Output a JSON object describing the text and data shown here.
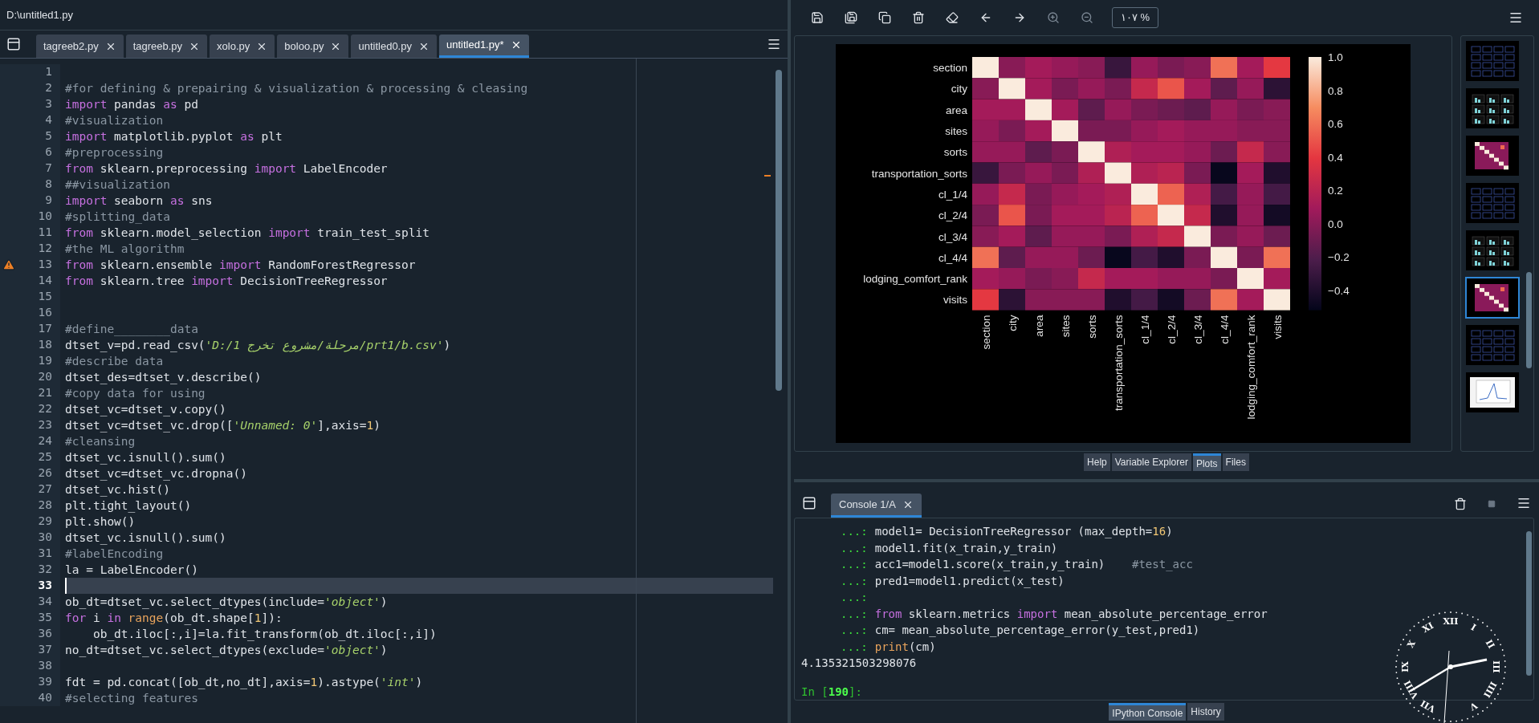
{
  "editor": {
    "path": "D:\\untitled1.py",
    "tabs": [
      {
        "label": "tagreeb2.py",
        "selected": false
      },
      {
        "label": "tagreeb.py",
        "selected": false
      },
      {
        "label": "xolo.py",
        "selected": false
      },
      {
        "label": "boloo.py",
        "selected": false
      },
      {
        "label": "untitled0.py",
        "selected": false
      },
      {
        "label": "untitled1.py*",
        "selected": true
      }
    ],
    "lines": [
      {
        "n": "1",
        "current": false,
        "warning": false
      },
      {
        "n": "2",
        "current": false,
        "warning": false,
        "tokens": [
          {
            "kind": "cm",
            "text": "#for defining & prepairing & visualization & processing & cleasing"
          }
        ]
      },
      {
        "n": "3",
        "current": false,
        "warning": false,
        "tokens": [
          {
            "kind": "kw",
            "text": "import"
          },
          {
            "kind": "p",
            "text": " pandas "
          },
          {
            "kind": "kw",
            "text": "as"
          },
          {
            "kind": "p",
            "text": " pd"
          }
        ]
      },
      {
        "n": "4",
        "current": false,
        "warning": false,
        "tokens": [
          {
            "kind": "cm",
            "text": "#visualization"
          }
        ]
      },
      {
        "n": "5",
        "current": false,
        "warning": false,
        "tokens": [
          {
            "kind": "kw",
            "text": "import"
          },
          {
            "kind": "p",
            "text": " matplotlib.pyplot "
          },
          {
            "kind": "kw",
            "text": "as"
          },
          {
            "kind": "p",
            "text": " plt"
          }
        ]
      },
      {
        "n": "6",
        "current": false,
        "warning": false,
        "tokens": [
          {
            "kind": "cm",
            "text": "#preprocessing"
          }
        ]
      },
      {
        "n": "7",
        "current": false,
        "warning": false,
        "tokens": [
          {
            "kind": "kw",
            "text": "from"
          },
          {
            "kind": "p",
            "text": " sklearn.preprocessing "
          },
          {
            "kind": "kw",
            "text": "import"
          },
          {
            "kind": "p",
            "text": " LabelEncoder"
          }
        ]
      },
      {
        "n": "8",
        "current": false,
        "warning": false,
        "tokens": [
          {
            "kind": "cm",
            "text": "##visualization"
          }
        ]
      },
      {
        "n": "9",
        "current": false,
        "warning": false,
        "tokens": [
          {
            "kind": "kw",
            "text": "import"
          },
          {
            "kind": "p",
            "text": " seaborn "
          },
          {
            "kind": "kw",
            "text": "as"
          },
          {
            "kind": "p",
            "text": " sns"
          }
        ]
      },
      {
        "n": "10",
        "current": false,
        "warning": false,
        "tokens": [
          {
            "kind": "cm",
            "text": "#splitting_data"
          }
        ]
      },
      {
        "n": "11",
        "current": false,
        "warning": false,
        "tokens": [
          {
            "kind": "kw",
            "text": "from"
          },
          {
            "kind": "p",
            "text": " sklearn.model_selection "
          },
          {
            "kind": "kw",
            "text": "import"
          },
          {
            "kind": "p",
            "text": " train_test_split"
          }
        ]
      },
      {
        "n": "12",
        "current": false,
        "warning": false,
        "tokens": [
          {
            "kind": "cm",
            "text": "#the ML algorithm"
          }
        ]
      },
      {
        "n": "13",
        "current": false,
        "warning": true,
        "tokens": [
          {
            "kind": "kw",
            "text": "from"
          },
          {
            "kind": "p",
            "text": " sklearn.ensemble "
          },
          {
            "kind": "kw",
            "text": "import"
          },
          {
            "kind": "p",
            "text": " RandomForestRegressor"
          }
        ]
      },
      {
        "n": "14",
        "current": false,
        "warning": false,
        "tokens": [
          {
            "kind": "kw",
            "text": "from"
          },
          {
            "kind": "p",
            "text": " sklearn.tree "
          },
          {
            "kind": "kw",
            "text": "import"
          },
          {
            "kind": "p",
            "text": " DecisionTreeRegressor"
          }
        ]
      },
      {
        "n": "15",
        "current": false,
        "warning": false
      },
      {
        "n": "16",
        "current": false,
        "warning": false
      },
      {
        "n": "17",
        "current": false,
        "warning": false,
        "tokens": [
          {
            "kind": "cm",
            "text": "#define________data"
          }
        ]
      },
      {
        "n": "18",
        "current": false,
        "warning": false,
        "tokens": [
          {
            "kind": "p",
            "text": "dtset_v=pd.read_csv("
          },
          {
            "kind": "str",
            "text": "'D:/1 مرحلة/مشروع تخرج/prt1/b.csv'"
          },
          {
            "kind": "p",
            "text": ")"
          }
        ]
      },
      {
        "n": "19",
        "current": false,
        "warning": false,
        "tokens": [
          {
            "kind": "cm",
            "text": "#describe data"
          }
        ]
      },
      {
        "n": "20",
        "current": false,
        "warning": false,
        "tokens": [
          {
            "kind": "p",
            "text": "dtset_des=dtset_v.describe()"
          }
        ]
      },
      {
        "n": "21",
        "current": false,
        "warning": false,
        "tokens": [
          {
            "kind": "cm",
            "text": "#copy data for using"
          }
        ]
      },
      {
        "n": "22",
        "current": false,
        "warning": false,
        "tokens": [
          {
            "kind": "p",
            "text": "dtset_vc=dtset_v.copy()"
          }
        ]
      },
      {
        "n": "23",
        "current": false,
        "warning": false,
        "tokens": [
          {
            "kind": "p",
            "text": "dtset_vc=dtset_vc.drop(["
          },
          {
            "kind": "str",
            "text": "'Unnamed: 0'"
          },
          {
            "kind": "p",
            "text": "],axis="
          },
          {
            "kind": "num",
            "text": "1"
          },
          {
            "kind": "p",
            "text": ")"
          }
        ]
      },
      {
        "n": "24",
        "current": false,
        "warning": false,
        "tokens": [
          {
            "kind": "cm",
            "text": "#cleansing"
          }
        ]
      },
      {
        "n": "25",
        "current": false,
        "warning": false,
        "tokens": [
          {
            "kind": "p",
            "text": "dtset_vc.isnull().sum()"
          }
        ]
      },
      {
        "n": "26",
        "current": false,
        "warning": false,
        "tokens": [
          {
            "kind": "p",
            "text": "dtset_vc=dtset_vc.dropna()"
          }
        ]
      },
      {
        "n": "27",
        "current": false,
        "warning": false,
        "tokens": [
          {
            "kind": "p",
            "text": "dtset_vc.hist()"
          }
        ]
      },
      {
        "n": "28",
        "current": false,
        "warning": false,
        "tokens": [
          {
            "kind": "p",
            "text": "plt.tight_layout()"
          }
        ]
      },
      {
        "n": "29",
        "current": false,
        "warning": false,
        "tokens": [
          {
            "kind": "p",
            "text": "plt.show()"
          }
        ]
      },
      {
        "n": "30",
        "current": false,
        "warning": false,
        "tokens": [
          {
            "kind": "p",
            "text": "dtset_vc.isnull().sum()"
          }
        ]
      },
      {
        "n": "31",
        "current": false,
        "warning": false,
        "tokens": [
          {
            "kind": "cm",
            "text": "#labelEncoding"
          }
        ]
      },
      {
        "n": "32",
        "current": false,
        "warning": false,
        "tokens": [
          {
            "kind": "p",
            "text": "la = LabelEncoder()"
          }
        ]
      },
      {
        "n": "33",
        "current": true,
        "warning": false
      },
      {
        "n": "34",
        "current": false,
        "warning": false,
        "tokens": [
          {
            "kind": "p",
            "text": "ob_dt=dtset_vc.select_dtypes(include="
          },
          {
            "kind": "str",
            "text": "'object'"
          },
          {
            "kind": "p",
            "text": ")"
          }
        ]
      },
      {
        "n": "35",
        "current": false,
        "warning": false,
        "tokens": [
          {
            "kind": "kw",
            "text": "for"
          },
          {
            "kind": "p",
            "text": " i "
          },
          {
            "kind": "kw",
            "text": "in"
          },
          {
            "kind": "bi",
            "text": " range"
          },
          {
            "kind": "p",
            "text": "(ob_dt.shape["
          },
          {
            "kind": "num",
            "text": "1"
          },
          {
            "kind": "p",
            "text": "]):"
          }
        ]
      },
      {
        "n": "36",
        "current": false,
        "warning": false,
        "tokens": [
          {
            "kind": "p",
            "text": "    ob_dt.iloc[:,i]=la.fit_transform(ob_dt.iloc[:,i])"
          }
        ]
      },
      {
        "n": "37",
        "current": false,
        "warning": false,
        "tokens": [
          {
            "kind": "p",
            "text": "no_dt=dtset_vc.select_dtypes(exclude="
          },
          {
            "kind": "str",
            "text": "'object'"
          },
          {
            "kind": "p",
            "text": ")"
          }
        ]
      },
      {
        "n": "38",
        "current": false,
        "warning": false
      },
      {
        "n": "39",
        "current": false,
        "warning": false,
        "tokens": [
          {
            "kind": "p",
            "text": "fdt = pd.concat([ob_dt,no_dt],axis="
          },
          {
            "kind": "num",
            "text": "1"
          },
          {
            "kind": "p",
            "text": ").astype("
          },
          {
            "kind": "str",
            "text": "'int'"
          },
          {
            "kind": "p",
            "text": ")"
          }
        ]
      },
      {
        "n": "40",
        "current": false,
        "warning": false,
        "tokens": [
          {
            "kind": "cm",
            "text": "#selecting features"
          }
        ]
      }
    ]
  },
  "plots": {
    "zoom": "١٠٧ %",
    "heatmap": {
      "row_labels": [
        "section",
        "city",
        "area",
        "sites",
        "sorts",
        "transportation_sorts",
        "cl_1/4",
        "cl_2/4",
        "cl_3/4",
        "cl_4/4",
        "lodging_comfort_rank",
        "visits"
      ],
      "column_labels": [
        "section",
        "city",
        "area",
        "sites",
        "sorts",
        "transportation_sorts",
        "cl_1/4",
        "cl_2/4",
        "cl_3/4",
        "cl_4/4",
        "lodging_comfort_rank",
        "visits"
      ],
      "colorbar_labels": [
        "1.0",
        "0.8",
        "0.6",
        "0.4",
        "0.2",
        "0.0",
        "−0.2",
        "−0.4"
      ]
    },
    "thumbnails": [
      {
        "kind": "grid",
        "selected": false
      },
      {
        "kind": "bars",
        "selected": false
      },
      {
        "kind": "heatmap",
        "selected": false
      },
      {
        "kind": "grid",
        "selected": false
      },
      {
        "kind": "bars",
        "selected": false
      },
      {
        "kind": "heatmap",
        "selected": true
      },
      {
        "kind": "grid",
        "selected": false
      },
      {
        "kind": "line",
        "selected": false
      }
    ],
    "pane_tabs": [
      {
        "label": "Help",
        "selected": false
      },
      {
        "label": "Variable Explorer",
        "selected": false
      },
      {
        "label": "Plots",
        "selected": true
      },
      {
        "label": "Files",
        "selected": false
      }
    ]
  },
  "console": {
    "tab": "Console 1/A",
    "lines": [
      {
        "kind": "continuation",
        "prompt": "...:",
        "tokens": [
          {
            "kind": "p",
            "text": "model1= DecisionTreeRegressor (max_depth="
          },
          {
            "kind": "num",
            "text": "16"
          },
          {
            "kind": "p",
            "text": ")"
          }
        ]
      },
      {
        "kind": "continuation",
        "prompt": "...:",
        "tokens": [
          {
            "kind": "p",
            "text": "model1.fit(x_train,y_train)"
          }
        ]
      },
      {
        "kind": "continuation",
        "prompt": "...:",
        "tokens": [
          {
            "kind": "p",
            "text": "acc1=model1.score(x_train,y_train)    "
          },
          {
            "kind": "cm",
            "text": "#test_acc"
          }
        ]
      },
      {
        "kind": "continuation",
        "prompt": "...:",
        "tokens": [
          {
            "kind": "p",
            "text": "pred1=model1.predict(x_test)"
          }
        ]
      },
      {
        "kind": "continuation",
        "prompt": "...:"
      },
      {
        "kind": "continuation",
        "prompt": "...:",
        "tokens": [
          {
            "kind": "kw",
            "text": "from"
          },
          {
            "kind": "p",
            "text": " sklearn.metrics "
          },
          {
            "kind": "kw",
            "text": "import"
          },
          {
            "kind": "p",
            "text": " mean_absolute_percentage_error"
          }
        ]
      },
      {
        "kind": "continuation",
        "prompt": "...:",
        "tokens": [
          {
            "kind": "p",
            "text": "cm= mean_absolute_percentage_error(y_test,pred1)"
          }
        ]
      },
      {
        "kind": "continuation",
        "prompt": "...:",
        "tokens": [
          {
            "kind": "bi",
            "text": "print"
          },
          {
            "kind": "p",
            "text": "(cm)"
          }
        ]
      },
      {
        "kind": "output",
        "text": "4.135321503298076"
      },
      {
        "kind": "blank"
      },
      {
        "kind": "input",
        "prompt": "In [**190**]:"
      }
    ],
    "bottom_tabs": [
      {
        "label": "IPython Console",
        "selected": true
      },
      {
        "label": "History",
        "selected": false
      }
    ]
  },
  "clock": {
    "numerals": [
      "XII",
      "I",
      "II",
      "III",
      "IIII",
      "V",
      "VII",
      "VIII",
      "IX",
      "X",
      "XI"
    ]
  }
}
